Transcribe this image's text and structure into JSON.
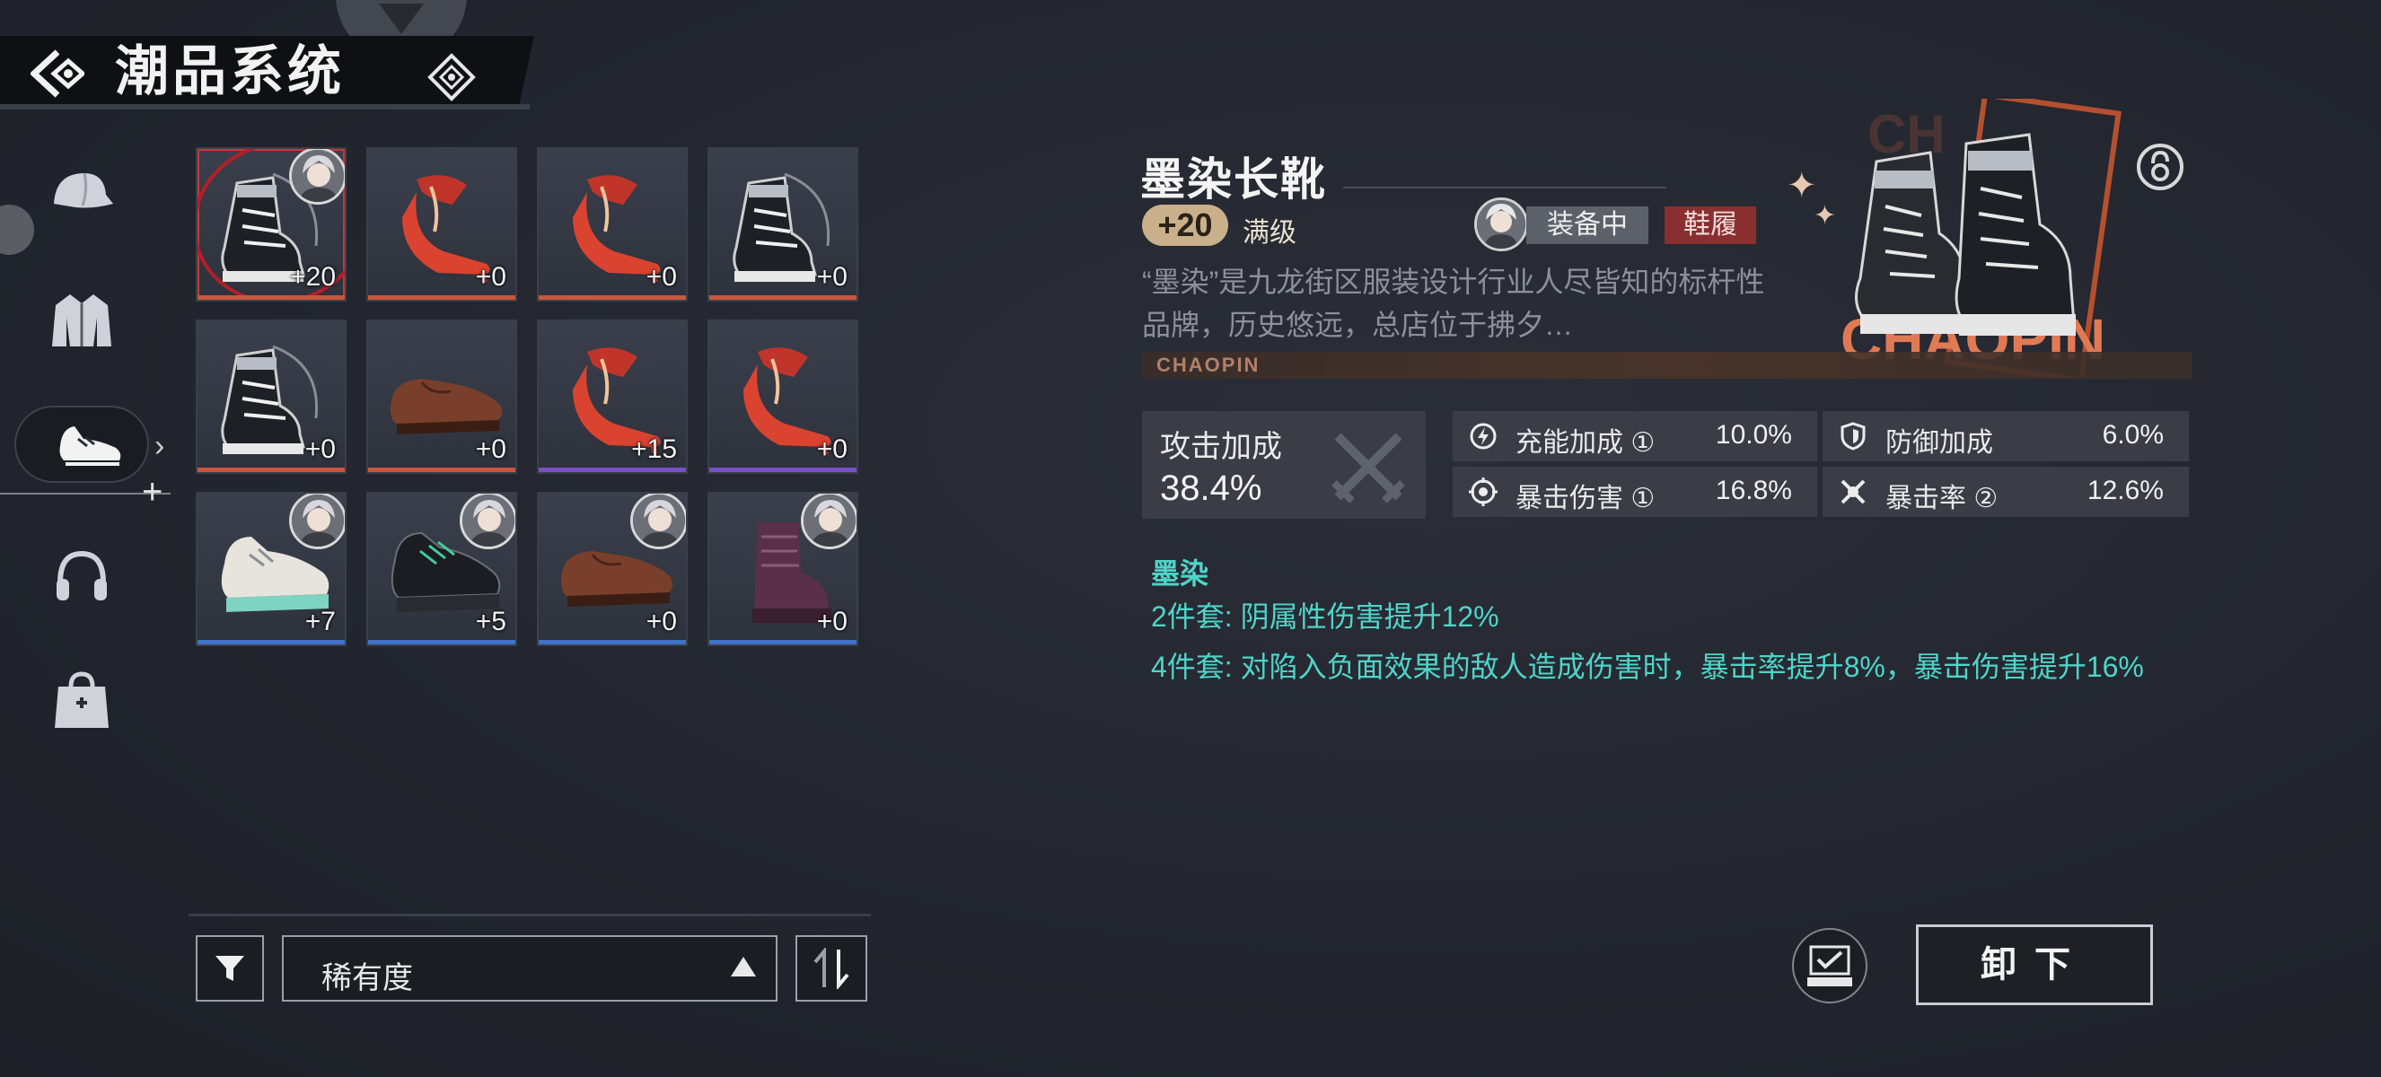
{
  "header": {
    "title": "潮品系统"
  },
  "sidebar": {
    "items": [
      {
        "icon": "cap-icon"
      },
      {
        "icon": "jacket-icon"
      },
      {
        "icon": "shoes-icon",
        "active": true
      },
      {
        "icon": "headphones-icon"
      },
      {
        "icon": "bag-icon"
      }
    ]
  },
  "grid": {
    "items": [
      {
        "type": "boots",
        "level": "+20",
        "rarity": "#c8573e",
        "avatar": true,
        "selected": true
      },
      {
        "type": "heels",
        "level": "+0",
        "rarity": "#c8573e"
      },
      {
        "type": "heels",
        "level": "+0",
        "rarity": "#c8573e"
      },
      {
        "type": "boots",
        "level": "+0",
        "rarity": "#c8573e"
      },
      {
        "type": "boots",
        "level": "+0",
        "rarity": "#c8573e"
      },
      {
        "type": "leather",
        "level": "+0",
        "rarity": "#c8573e"
      },
      {
        "type": "heels",
        "level": "+15",
        "rarity": "#7b4fc9"
      },
      {
        "type": "heels",
        "level": "+0",
        "rarity": "#7b4fc9"
      },
      {
        "type": "sneaker",
        "level": "+7",
        "rarity": "#3f72c8",
        "avatar": true
      },
      {
        "type": "black-sneaker",
        "level": "+5",
        "rarity": "#3f72c8",
        "avatar": true
      },
      {
        "type": "leather",
        "level": "+0",
        "rarity": "#3f72c8",
        "avatar": true
      },
      {
        "type": "purple-boot",
        "level": "+0",
        "rarity": "#3f72c8",
        "avatar": true
      }
    ]
  },
  "filter": {
    "sort_label": "稀有度"
  },
  "detail": {
    "name": "墨染长靴",
    "level": "+20",
    "max_label": "满级",
    "equipped_label": "装备中",
    "slot_label": "鞋履",
    "description": "“墨染”是九龙街区服装设计行业人尽皆知的标杆性品牌，历史悠远，总店位于拂夕…",
    "ad_text": "CHAOPIN",
    "art_text": "CHAOPIN",
    "main_stat": {
      "label": "攻击加成",
      "value": "38.4%"
    },
    "sub_stats": [
      {
        "label": "充能加成 ①",
        "value": "10.0%",
        "icon": "energy-icon"
      },
      {
        "label": "防御加成",
        "value": "6.0%",
        "icon": "shield-icon"
      },
      {
        "label": "暴击伤害 ①",
        "value": "16.8%",
        "icon": "crit-damage-icon"
      },
      {
        "label": "暴击率 ②",
        "value": "12.6%",
        "icon": "crit-rate-icon"
      }
    ],
    "set_name": "墨染",
    "set_2": "2件套: 阴属性伤害提升12%",
    "set_4": "4件套: 对陷入负面效果的敌人造成伤害时，暴击率提升8%，暴击伤害提升16%"
  },
  "actions": {
    "unequip_label": "卸下"
  },
  "colors": {
    "accent_teal": "#4fd4c9",
    "equip_red": "#8a2f2f",
    "level_gold": "#c9b08a"
  }
}
